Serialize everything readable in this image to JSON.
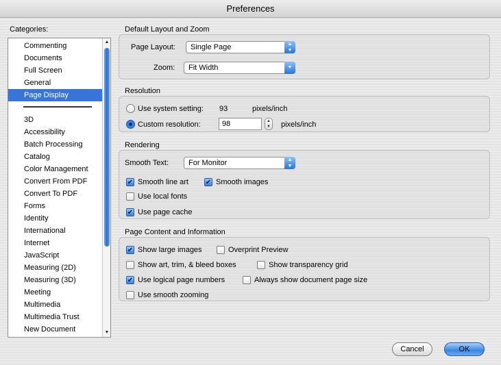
{
  "window": {
    "title": "Preferences"
  },
  "categories": {
    "label": "Categories:",
    "items": [
      "Commenting",
      "Documents",
      "Full Screen",
      "General",
      "Page Display",
      "3D",
      "Accessibility",
      "Batch Processing",
      "Catalog",
      "Color Management",
      "Convert From PDF",
      "Convert To PDF",
      "Forms",
      "Identity",
      "International",
      "Internet",
      "JavaScript",
      "Measuring (2D)",
      "Measuring (3D)",
      "Meeting",
      "Multimedia",
      "Multimedia Trust",
      "New Document"
    ],
    "selected": "Page Display"
  },
  "layout_zoom": {
    "group_label": "Default Layout and Zoom",
    "page_layout_label": "Page Layout:",
    "page_layout_value": "Single Page",
    "zoom_label": "Zoom:",
    "zoom_value": "Fit Width"
  },
  "resolution": {
    "group_label": "Resolution",
    "system_label": "Use system setting:",
    "system_value": "93",
    "system_unit": "pixels/inch",
    "custom_label": "Custom resolution:",
    "custom_value": "98",
    "custom_unit": "pixels/inch",
    "selected": "custom"
  },
  "rendering": {
    "group_label": "Rendering",
    "smooth_text_label": "Smooth Text:",
    "smooth_text_value": "For Monitor",
    "smooth_line_art": "Smooth line art",
    "smooth_images": "Smooth images",
    "local_fonts": "Use local fonts",
    "page_cache": "Use page cache",
    "checked": {
      "smooth_line_art": true,
      "smooth_images": true,
      "local_fonts": false,
      "page_cache": true
    }
  },
  "page_content": {
    "group_label": "Page Content and Information",
    "large_images": "Show large images",
    "overprint": "Overprint Preview",
    "art_trim": "Show art, trim, & bleed boxes",
    "transparency": "Show transparency grid",
    "logical_numbers": "Use logical page numbers",
    "doc_page_size": "Always show document page size",
    "smooth_zooming": "Use smooth zooming",
    "checked": {
      "large_images": true,
      "overprint": false,
      "art_trim": false,
      "transparency": false,
      "logical_numbers": true,
      "doc_page_size": false,
      "smooth_zooming": false
    }
  },
  "buttons": {
    "cancel": "Cancel",
    "ok": "OK"
  },
  "icons": {
    "checkmark": "✔",
    "up_arrow": "▲",
    "down_arrow": "▼"
  },
  "colors": {
    "selection": "#3875d7",
    "accent": "#2b76d7"
  }
}
